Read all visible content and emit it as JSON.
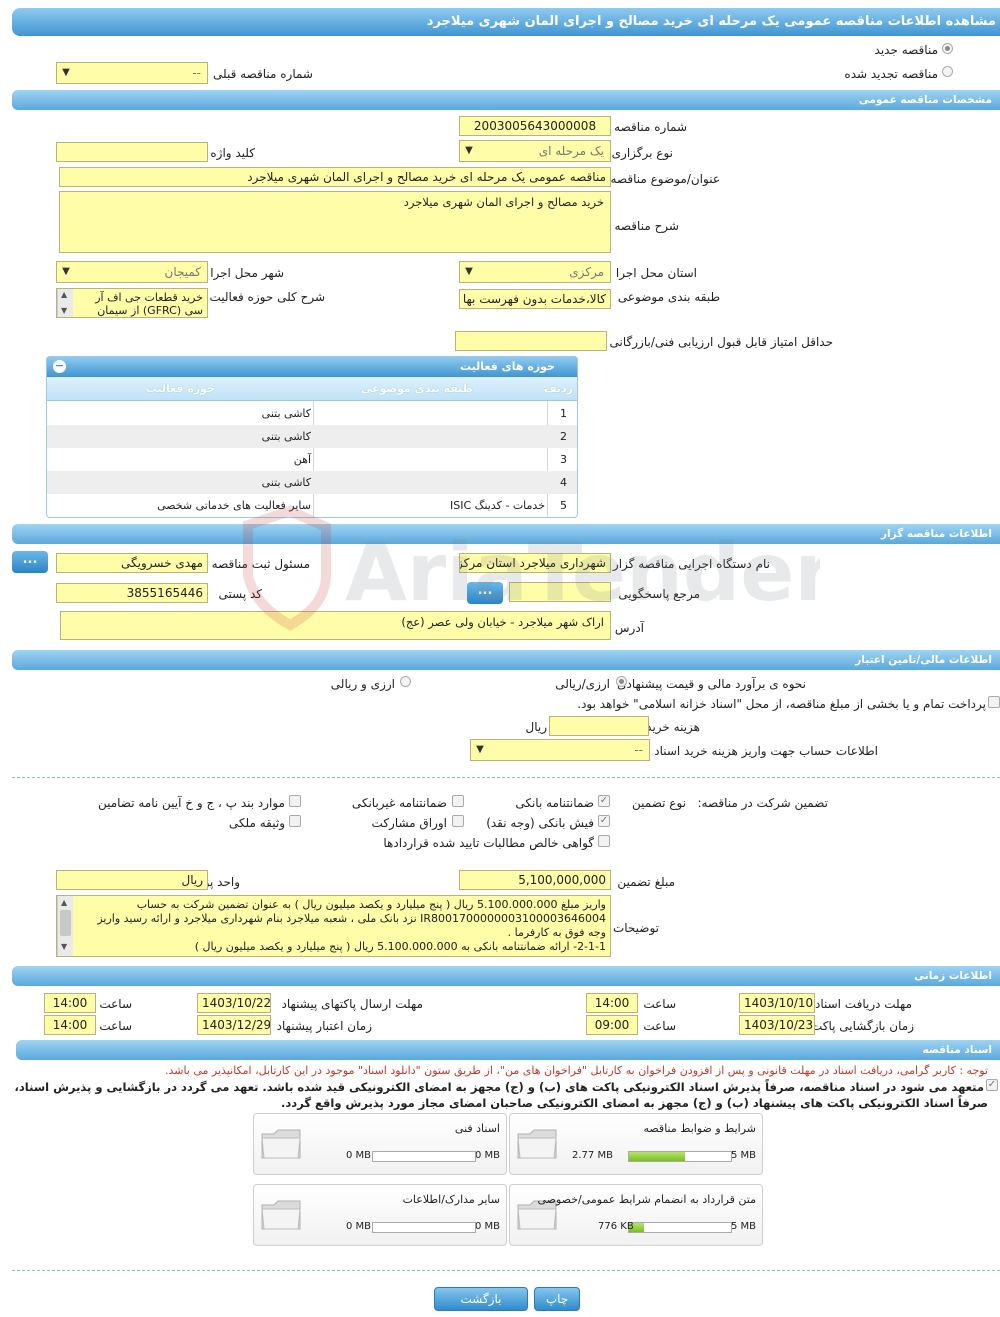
{
  "title": "مشاهده اطلاعات مناقصه عمومی یک مرحله ای خرید مصالح و اجرای المان شهری میلاجرد",
  "tender_type": {
    "new_label": "مناقصه جدید",
    "renewed_label": "مناقصه تجدید شده",
    "prev_number_label": "شماره مناقصه قبلی",
    "prev_number_value": "--"
  },
  "general": {
    "section": "مشخصات مناقصه عمومی",
    "number_label": "شماره مناقصه",
    "number_value": "2003005643000008",
    "holding_type_label": "نوع برگزاری",
    "holding_type_value": "یک مرحله ای",
    "keyword_label": "کلید واژه",
    "keyword_value": "",
    "subject_label": "عنوان/موضوع مناقصه",
    "subject_value": "مناقصه عمومی یک مرحله ای خرید مصالح  و  اجرای المان شهری میلاجرد",
    "desc_label": "شرح مناقصه",
    "desc_value": "خرید مصالح  و  اجرای المان شهری میلاجرد",
    "province_label": "استان محل اجرا",
    "province_value": "مرکزی",
    "city_label": "شهر محل اجرا",
    "city_value": "کمیجان",
    "category_label": "طبقه بندی موضوعی",
    "category_value": "کالا،خدمات بدون فهرست بها",
    "scope_label": "شرح کلی حوزه فعالیت",
    "scope_value": "خرید قطعات جی اف آر سی (GFRC) از سیمان",
    "min_score_label": "حداقل امتیاز قابل قبول ارزیابی فنی/بازرگانی",
    "min_score_value": ""
  },
  "activities": {
    "title": "حوزه های فعالیت",
    "col_row": "ردیف",
    "col_category": "طبقه بندی موضوعی",
    "col_field": "حوزه فعالیت",
    "rows": [
      {
        "n": "1",
        "cat": "",
        "field": "کاشی بتنی"
      },
      {
        "n": "2",
        "cat": "",
        "field": "کاشی بتنی"
      },
      {
        "n": "3",
        "cat": "",
        "field": "آهن"
      },
      {
        "n": "4",
        "cat": "",
        "field": "کاشی بتنی"
      },
      {
        "n": "5",
        "cat": "خدمات - کدینگ ISIC",
        "field": "سایر فعالیت های خدماتی شخصی"
      }
    ]
  },
  "organizer": {
    "section": "اطلاعات مناقصه گزار",
    "org_label": "نام دستگاه اجرایی مناقصه گزار",
    "org_value": "شهرداری میلاجرد استان مرکزی",
    "registrar_label": "مسئول ثبت مناقصه",
    "registrar_value": "مهدی خسرویگی",
    "reference_label": "مرجع پاسخگویی",
    "reference_value": "",
    "postal_label": "کد پستی",
    "postal_value": "3855165446",
    "address_label": "آدرس",
    "address_value": "اراک شهر میلاجرد - خیابان ولی عصر (عج)",
    "dots": "..."
  },
  "finance": {
    "section": "اطلاعات مالی/تامین اعتبار",
    "estimate_label": "نحوه ی برآورد مالی و قیمت پیشنهادی",
    "opt_rial": "ارزی/ریالی",
    "opt_both": "ارزی و ریالی",
    "treasury_text": "پرداخت تمام و یا بخشی از مبلغ مناقصه، از محل \"اسناد خزانه اسلامی\" خواهد بود.",
    "doc_cost_label": "هزینه خرید اسناد",
    "doc_cost_unit": "ریال",
    "doc_cost_value": "",
    "account_label": "اطلاعات حساب جهت واریز هزینه خرید اسناد",
    "account_value": "--"
  },
  "guarantee": {
    "title": "تضمین شرکت در مناقصه:",
    "type_label": "نوع تضمین",
    "opts": {
      "bank_guarantee": "ضمانتنامه بانکی",
      "non_bank": "ضمانتنامه غیربانکی",
      "bylaw": "موارد بند پ ، ج و خ آیین نامه تضامین",
      "bank_receipt": "فیش بانکی (وجه نقد)",
      "bonds": "اوراق مشارکت",
      "property": "وثیقه ملکی",
      "claims": "گواهی خالص مطالبات تایید شده قراردادها"
    },
    "amount_label": "مبلغ تضمین",
    "amount_value": "5,100,000,000",
    "currency_label": "واحد پول",
    "currency_value": "ریال",
    "notes_label": "توضیحات",
    "notes_lines": [
      "واریز مبلغ 5.100.000.000 ریال ( پنج میلیارد و یکصد  میلیون  ریال ) به عنوان تضمین شرکت به حساب",
      "IR800170000000310000364600​4   نزد بانک ملی ، شعبه میلاجرد بنام شهرداری میلاجرد و ارائه رسید واریز",
      "وجه فوق به کارفرما .",
      "2-1-1- ارائه ضمانتنامه بانکی به 5.100.000.000 ریال ( پنج میلیارد و یکصد  میلیون  ریال )"
    ]
  },
  "timing": {
    "section": "اطلاعات زمانی",
    "receive_label": "مهلت دریافت اسناد",
    "receive_date": "1403/10/10",
    "receive_time": "14:00",
    "send_label": "مهلت ارسال پاکتهای پیشنهاد",
    "send_date": "1403/10/22",
    "send_time": "14:00",
    "open_label": "زمان بازگشایی پاکت ها",
    "open_date": "1403/10/23",
    "open_time": "09:00",
    "valid_label": "زمان اعتبار پیشنهاد",
    "valid_date": "1403/12/29",
    "valid_time": "14:00",
    "time_label": "ساعت"
  },
  "documents": {
    "section": "اسناد مناقصه",
    "note_red": "توجه : کاربر گرامی، دریافت اسناد در مهلت قانونی و پس از افزودن فراخوان به کارتابل \"فراخوان های من\"، از طریق ستون \"دانلود اسناد\" موجود در این کارتابل، امکانپذیر می باشد.",
    "commit_1": "متعهد می شود در اسناد مناقصه، صرفاً پذیرش اسناد الکترونیکی پاکت های (ب) و (ج) مجهز به امضای الکترونیکی قید شده باشد. تعهد می گردد در بازگشایی و پذیرش اسناد،",
    "commit_2": "صرفاً اسناد الکترونیکی پاکت های پیشنهاد (ب) و (ج) مجهز به امضای الکترونیکی صاحبان امضای مجاز مورد پذیرش واقع گردد.",
    "tiles": [
      {
        "name": "شرایط و ضوابط مناقصه",
        "current": "2.77 MB",
        "max": "5 MB",
        "fill": 0.55
      },
      {
        "name": "اسناد فنی",
        "current": "0 MB",
        "max": "50 MB",
        "fill": 0
      },
      {
        "name": "متن قرارداد به انضمام شرایط عمومی/خصوصی",
        "current": "776 KB",
        "max": "5 MB",
        "fill": 0.15
      },
      {
        "name": "سایر مدارک/اطلاعات",
        "current": "0 MB",
        "max": "50 MB",
        "fill": 0
      }
    ]
  },
  "buttons": {
    "print": "چاپ",
    "back": "بازگشت"
  },
  "watermark": "AriaTender.neT",
  "colors": {
    "header": "#3f95d2",
    "field_bg": "#fffda8",
    "note_red": "#c0392b",
    "progress": "#78c11e"
  }
}
